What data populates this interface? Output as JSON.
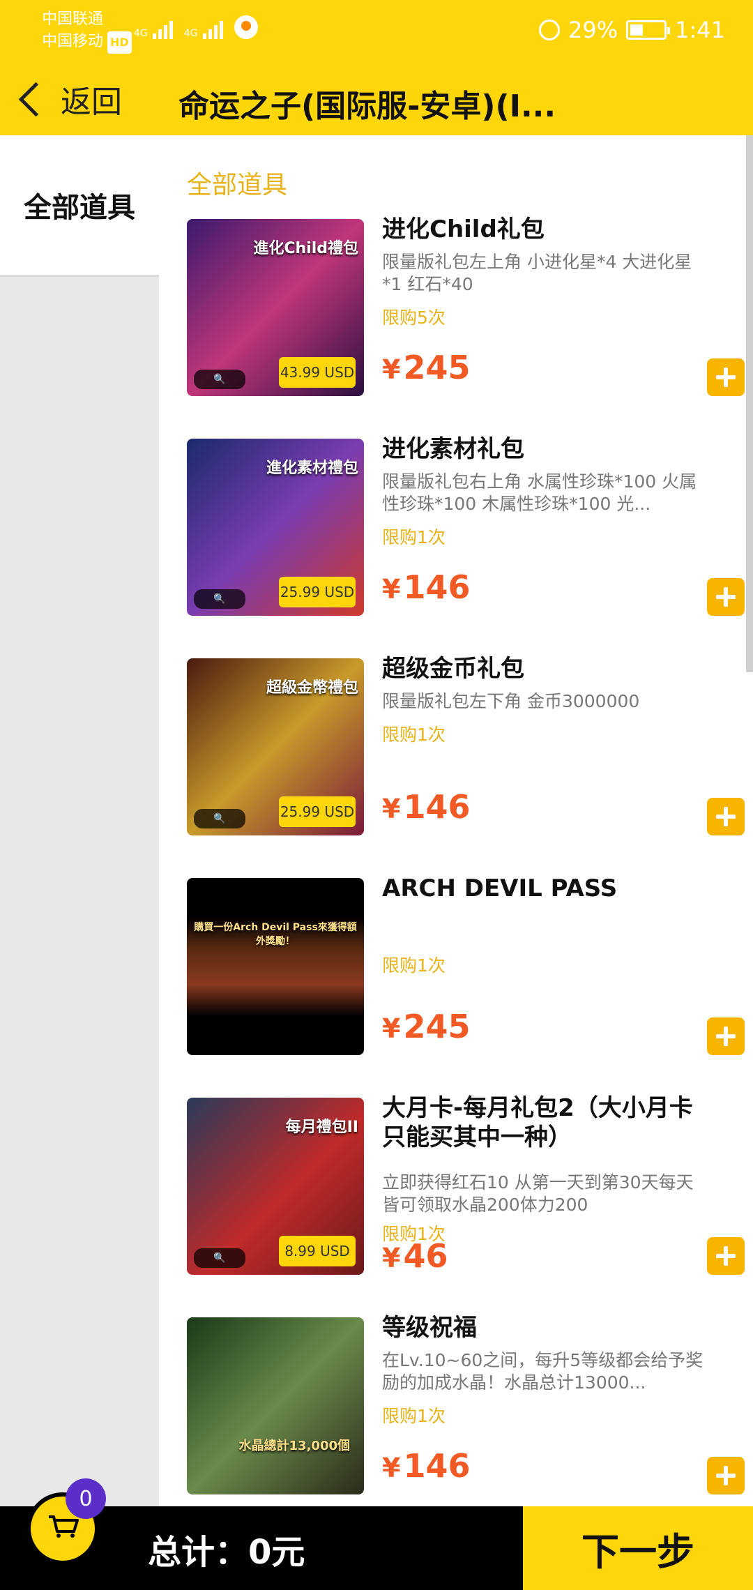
{
  "status_bar": {
    "carrier1": "中国联通",
    "carrier2": "中国移动",
    "hd": "HD",
    "net1": "4G",
    "net2": "4G",
    "battery": "29%",
    "time": "1:41"
  },
  "header": {
    "back_label": "返回",
    "title": "命运之子(国际服-安卓)(I..."
  },
  "sidebar": {
    "items": [
      {
        "label": "全部道具"
      }
    ]
  },
  "main": {
    "section_title": "全部道具",
    "items": [
      {
        "name": "进化Child礼包",
        "desc": "限量版礼包左上角 小进化星*4 大进化星*1 红石*40",
        "limit": "限购5次",
        "currency": "¥",
        "price": "245",
        "thumb_caption": "進化Child禮包",
        "thumb_price": "43.99 USD",
        "thumb_bg": "linear-gradient(135deg,#3b1a6d,#c0367a 50%,#2b1040)"
      },
      {
        "name": "进化素材礼包",
        "desc": "限量版礼包右上角 水属性珍珠*100 火属性珍珠*100 木属性珍珠*100 光...",
        "limit": "限购1次",
        "currency": "¥",
        "price": "146",
        "thumb_caption": "進化素材禮包",
        "thumb_price": "25.99 USD",
        "thumb_bg": "linear-gradient(135deg,#1a2a6d,#7a3cb0 50%,#d03a2a)"
      },
      {
        "name": "超级金币礼包",
        "desc": "限量版礼包左下角 金币3000000",
        "limit": "限购1次",
        "currency": "¥",
        "price": "146",
        "thumb_caption": "超級金幣禮包",
        "thumb_price": "25.99 USD",
        "thumb_bg": "linear-gradient(135deg,#4a1a10,#c89a2a 50%,#7a1a3a)"
      },
      {
        "name": "ARCH DEVIL PASS",
        "desc": "",
        "limit": "限购1次",
        "currency": "¥",
        "price": "245",
        "thumb_caption": "購買一份Arch Devil Pass來獲得額外獎勵！",
        "thumb_price": "",
        "thumb_bg": "linear-gradient(180deg,#000 0%,#000 22%,#5a2a10 40%,#8a3a20 60%,#000 78%,#000 100%)"
      },
      {
        "name": "大月卡-每月礼包2（大小月卡只能买其中一种）",
        "desc": "立即获得红石10 从第一天到第30天每天皆可领取水晶200体力200",
        "limit": "限购1次",
        "currency": "¥",
        "price": "46",
        "thumb_caption": "每月禮包II",
        "thumb_price": "8.99 USD",
        "thumb_bg": "linear-gradient(135deg,#2a3a5a,#c02a2a 55%,#6a1a1a)"
      },
      {
        "name": "等级祝福",
        "desc": "在Lv.10~60之间，每升5等级都会给予奖励的加成水晶！水晶总计13000...",
        "limit": "限购1次",
        "currency": "¥",
        "price": "146",
        "thumb_caption": "水晶總計13,000個",
        "thumb_price": "",
        "thumb_bg": "linear-gradient(135deg,#1a3a1a,#6a8a4a 50%,#2a2a1a)"
      }
    ]
  },
  "footer": {
    "cart_count": "0",
    "total_label": "总计：0元",
    "next_label": "下一步"
  }
}
